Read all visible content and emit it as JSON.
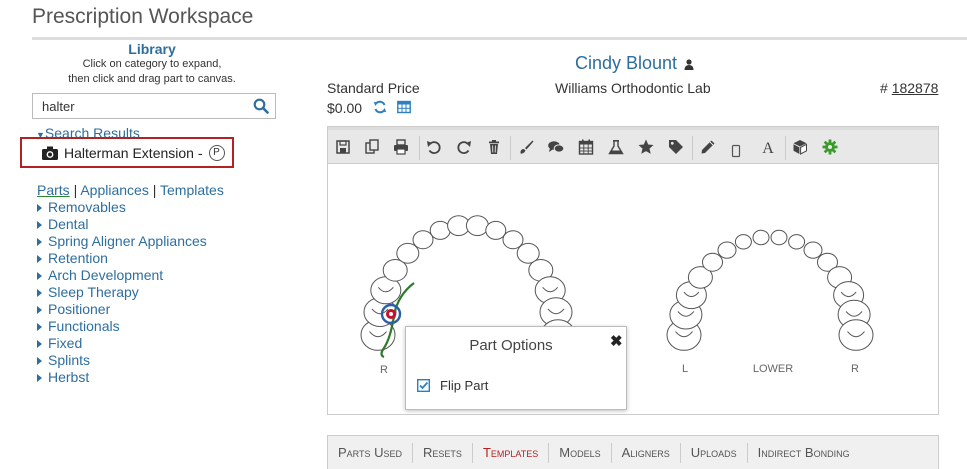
{
  "page": {
    "title": "Prescription Workspace"
  },
  "library": {
    "title": "Library",
    "hint_line1": "Click on category to expand,",
    "hint_line2": "then click and drag part to canvas.",
    "search_value": "halter",
    "results_label": "Search Results",
    "result": {
      "name": "Halterman Extension -",
      "badge": "P"
    },
    "tabs": {
      "parts": "Parts",
      "sep1": " | ",
      "appliances": "Appliances",
      "sep2": " | ",
      "templates": "Templates"
    },
    "categories": [
      "Removables",
      "Dental",
      "Spring Aligner Appliances",
      "Retention",
      "Arch Development",
      "Sleep Therapy",
      "Positioner",
      "Functionals",
      "Fixed",
      "Splints",
      "Herbst"
    ]
  },
  "patient": {
    "name": "Cindy Blount"
  },
  "pricing": {
    "label": "Standard Price",
    "value": "$0.00"
  },
  "lab": {
    "name": "Williams Orthodontic Lab"
  },
  "order": {
    "prefix": "# ",
    "number": "182878"
  },
  "canvas": {
    "upper_right_label": "R",
    "lower_left_label": "L",
    "lower_label": "LOWER",
    "lower_right_label": "R"
  },
  "part_options": {
    "title": "Part Options",
    "close": "✖",
    "flip_label": "Flip Part",
    "flip_checked": true
  },
  "bottom_tabs": [
    {
      "label": "Parts Used",
      "active": false
    },
    {
      "label": "Resets",
      "active": false
    },
    {
      "label": "Templates",
      "active": true
    },
    {
      "label": "Models",
      "active": false
    },
    {
      "label": "Aligners",
      "active": false
    },
    {
      "label": "Uploads",
      "active": false
    },
    {
      "label": "Indirect Bonding",
      "active": false
    }
  ],
  "colors": {
    "link": "#2e6e9e",
    "highlight_border": "#b22222",
    "active_tab": "#b22222",
    "wire": "#2a7a2a"
  }
}
